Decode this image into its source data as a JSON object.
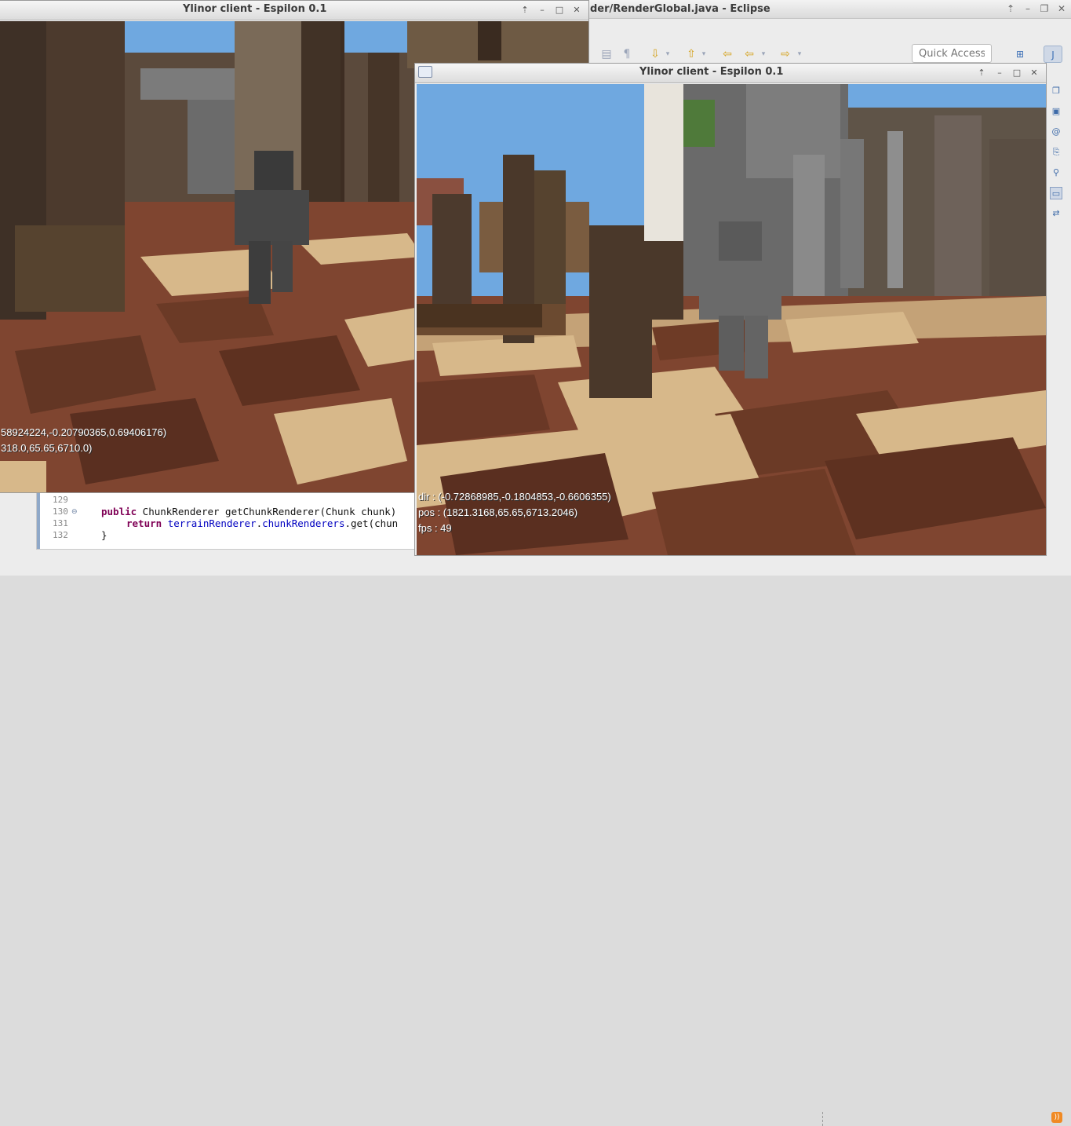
{
  "eclipse": {
    "title": "der/RenderGlobal.java - Eclipse",
    "quick_access_placeholder": "Quick Access",
    "colors": {
      "titlebar": "#e4e4e4",
      "perspective_active": "#cfd8e6"
    }
  },
  "editor": {
    "lines": [
      {
        "number": "129",
        "text": ""
      },
      {
        "number": "130",
        "text": "public ChunkRenderer getChunkRenderer(Chunk chunk)"
      },
      {
        "number": "131",
        "text": "return terrainRenderer.chunkRenderers.get(chun"
      },
      {
        "number": "132",
        "text": "}"
      }
    ],
    "line130": {
      "keyword": "public",
      "rest": " ChunkRenderer getChunkRenderer(Chunk chunk)"
    },
    "line131": {
      "keyword": "return",
      "field1": "terrainRenderer",
      "dot1": ".",
      "field2": "chunkRenderers",
      "rest": ".get(chun"
    },
    "line132": {
      "text": "}"
    }
  },
  "client_back": {
    "title": "Ylinor client - Espilon 0.1",
    "hud_dir": "58924224,-0.20790365,0.69406176)",
    "hud_pos": "318.0,65.65,6710.0)"
  },
  "client_front": {
    "title": "Ylinor client - Espilon 0.1",
    "hud_dir": "dir : (-0.72868985,-0.1804853,-0.6606355)",
    "hud_pos": "pos : (1821.3168,65.65,6713.2046)",
    "hud_fps": "fps : 49"
  },
  "scene_colors": {
    "sky": "#6fa8e0",
    "floor_dark": "#6e3b26",
    "floor_mid": "#7f4530",
    "floor_light": "#d7b88a",
    "log": "#4a382a",
    "stone": "#6c6c6c",
    "character": "#4a4a4a"
  }
}
